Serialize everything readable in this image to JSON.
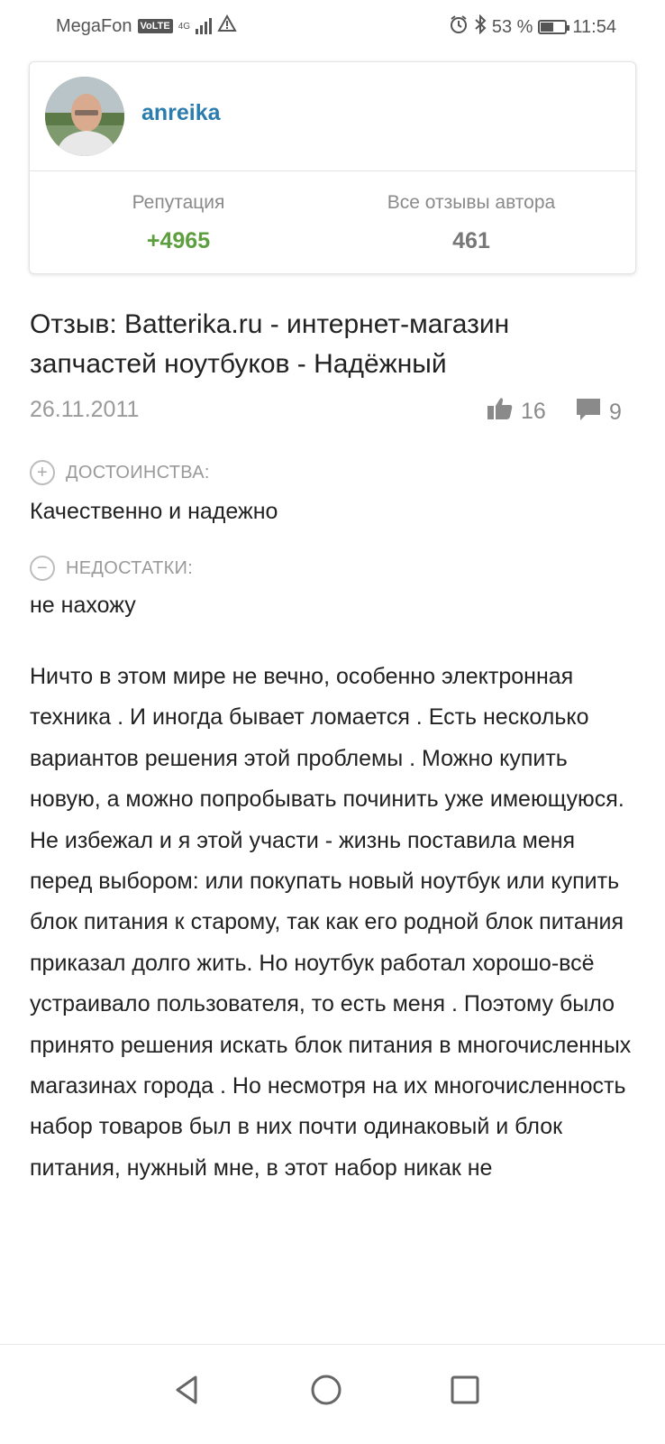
{
  "status_bar": {
    "carrier": "MegaFon",
    "volte": "VoLTE",
    "network": "4G",
    "battery": "53 %",
    "time": "11:54"
  },
  "profile": {
    "username": "anreika",
    "reputation_label": "Репутация",
    "reputation_value": "+4965",
    "reviews_label": "Все отзывы автора",
    "reviews_value": "461"
  },
  "review": {
    "title": "Отзыв: Batterika.ru - интернет-магазин запчастей ноутбуков - Надёжный",
    "date": "26.11.2011",
    "likes": "16",
    "comments": "9",
    "pros_label": "ДОСТОИНСТВА:",
    "pros_text": "Качественно и надежно",
    "cons_label": "НЕДОСТАТКИ:",
    "cons_text": "не нахожу",
    "body": "Ничто в этом мире не вечно, особенно электронная техника . И иногда бывает ломается . Есть несколько вариантов решения этой проблемы . Можно купить новую, а можно попробывать починить уже имеющуюся.\nНе избежал и я этой участи - жизнь поставила меня перед выбором: или покупать новый ноутбук или купить блок питания к старому, так как его родной блок питания приказал долго жить. Но ноутбук работал хорошо-всё устраивало пользователя, то есть меня . Поэтому было принято решения искать блок питания в многочисленных магазинах города . Но несмотря на их многочисленность набор товаров был в них почти одинаковый и блок питания, нужный мне, в этот набор никак не"
  },
  "colors": {
    "username": "#2a7dad",
    "reputation": "#5d9f3e",
    "muted": "#9a9a9a"
  }
}
